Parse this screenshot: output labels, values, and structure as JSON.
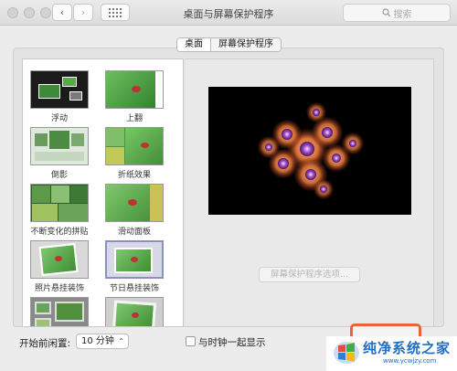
{
  "window": {
    "title": "桌面与屏幕保护程序"
  },
  "toolbar": {
    "back": "‹",
    "forward": "›",
    "search_placeholder": "搜索"
  },
  "tabs": [
    {
      "label": "桌面"
    },
    {
      "label": "屏幕保护程序"
    }
  ],
  "screensavers": [
    {
      "label": "浮动"
    },
    {
      "label": "上翻"
    },
    {
      "label": "倒影"
    },
    {
      "label": "折纸效果"
    },
    {
      "label": "不断变化的拼贴"
    },
    {
      "label": "滑动面板"
    },
    {
      "label": "照片悬挂装饰"
    },
    {
      "label": "节日悬挂装饰"
    },
    {
      "label": ""
    },
    {
      "label": ""
    }
  ],
  "options_button": {
    "label": "屏幕保护程序选项..."
  },
  "idle": {
    "label": "开始前闲置:",
    "value": "10 分钟"
  },
  "clock": {
    "label": "与时钟一起显示",
    "checked": false
  },
  "watermark": {
    "main": "纯净系统之家",
    "sub": "www.ycwjzy.com"
  },
  "colors": {
    "accent": "#f06234",
    "watermark": "#1f6fc8"
  }
}
